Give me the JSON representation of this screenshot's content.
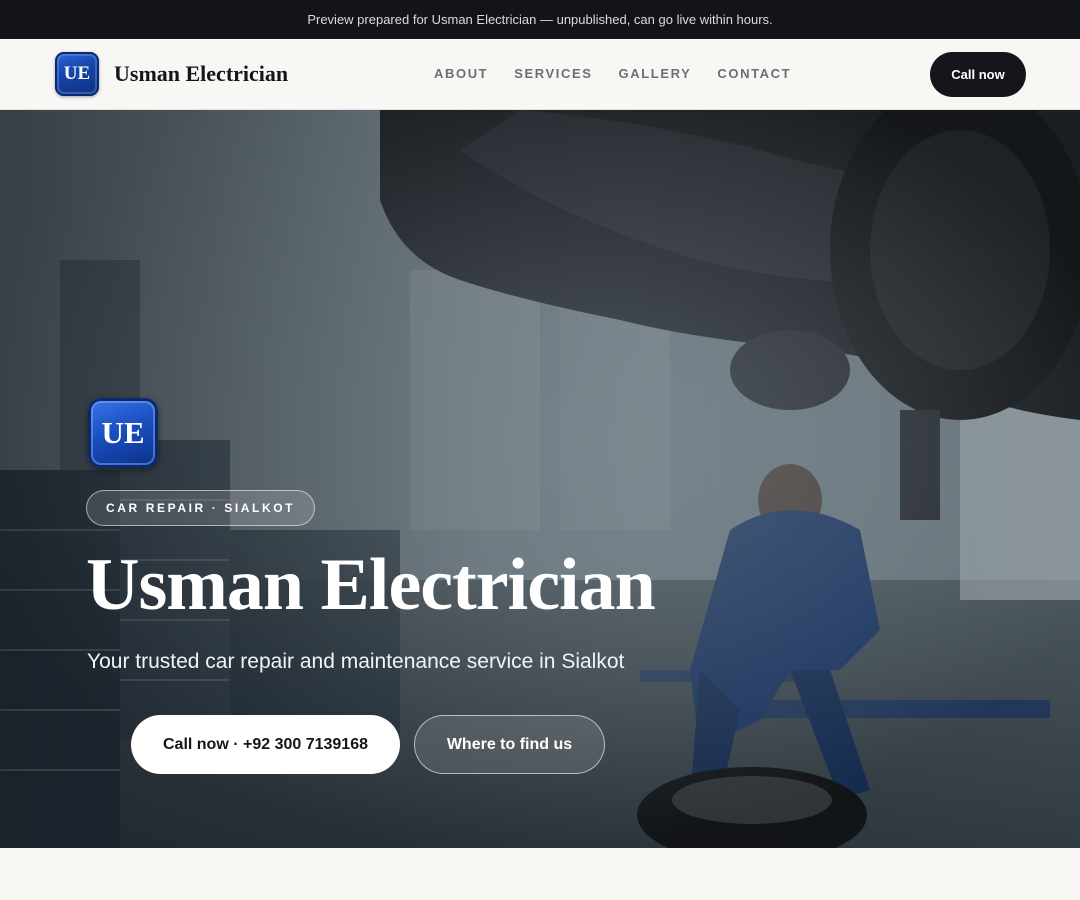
{
  "banner": {
    "text": "Preview prepared for Usman Electrician — unpublished, can go live within hours."
  },
  "header": {
    "logo_initials": "UE",
    "brand_name": "Usman Electrician",
    "nav": [
      "ABOUT",
      "SERVICES",
      "GALLERY",
      "CONTACT"
    ],
    "cta_label": "Call now"
  },
  "hero": {
    "badge_initials": "UE",
    "tag": "CAR REPAIR · SIALKOT",
    "title": "Usman Electrician",
    "subtitle": "Your trusted car repair and maintenance service in Sialkot",
    "primary_button": "Call now · +92 300 7139168",
    "secondary_button": "Where to find us",
    "background_image": "mechanic-under-car-photo"
  },
  "colors": {
    "banner_bg": "#121419",
    "header_bg": "#f8f7f4",
    "dark_button": "#14161b",
    "badge_blue": "#1a4fc0"
  }
}
